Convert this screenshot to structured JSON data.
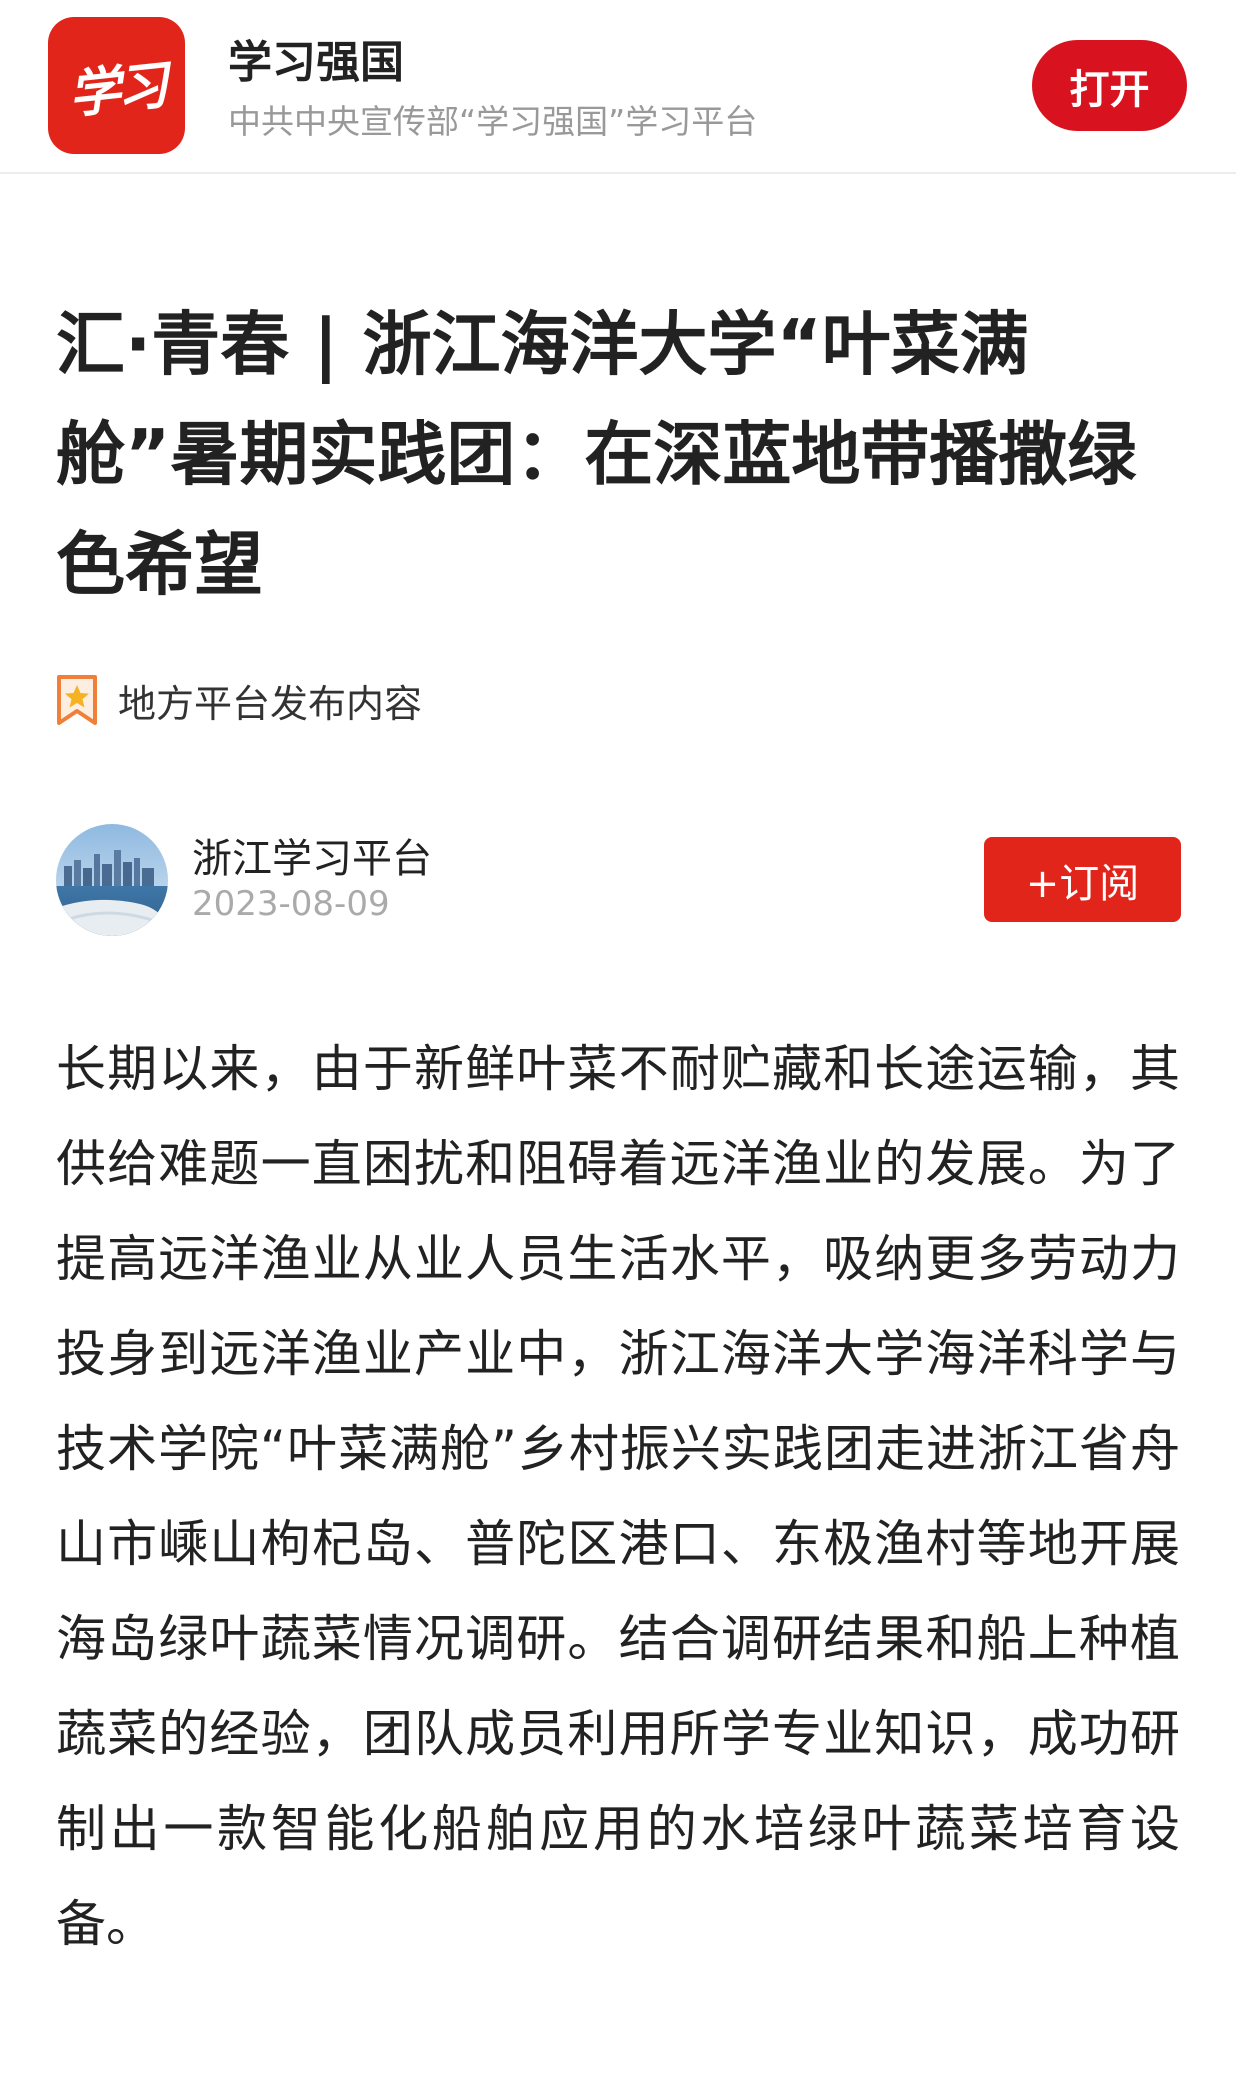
{
  "app_banner": {
    "logo_text": "学习",
    "app_name": "学习强国",
    "subtitle": "中共中央宣传部“学习强国”学习平台",
    "open_label": "打开"
  },
  "article": {
    "title": "汇·青春 | 浙江海洋大学“叶菜满舱”暑期实践团：在深蓝地带播撒绿色希望",
    "source_tag": "地方平台发布内容",
    "author": {
      "name": "浙江学习平台",
      "date": "2023-08-09",
      "subscribe_label": "+订阅"
    },
    "body": "长期以来，由于新鲜叶菜不耐贮藏和长途运输，其供给难题一直困扰和阻碍着远洋渔业的发展。为了提高远洋渔业从业人员生活水平，吸纳更多劳动力投身到远洋渔业产业中，浙江海洋大学海洋科学与技术学院“叶菜满舱”乡村振兴实践团走进浙江省舟山市嵊山枸杞岛、普陀区港口、东极渔村等地开展海岛绿叶蔬菜情况调研。结合调研结果和船上种植蔬菜的经验，团队成员利用所学专业知识，成功研制出一款智能化船舶应用的水培绿叶蔬菜培育设备。"
  },
  "colors": {
    "brand_red": "#e1251b",
    "open_button_red": "#d8121f",
    "subtitle_gray": "#999999",
    "date_gray": "#aaaaaa",
    "text_dark": "#222222"
  },
  "icons": {
    "app_logo": "xuexi-logo-icon",
    "source_tag": "star-bookmark-icon",
    "avatar": "city-skyline-avatar"
  }
}
